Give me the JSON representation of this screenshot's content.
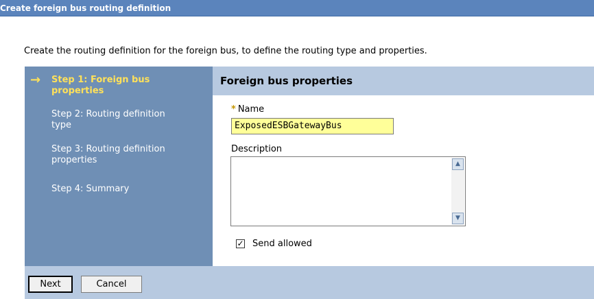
{
  "window": {
    "title": "Create foreign bus routing definition"
  },
  "intro_text": "Create the routing definition for the foreign bus, to define the routing type and properties.",
  "steps": [
    {
      "label": "Step 1: Foreign bus properties",
      "current": true
    },
    {
      "label": "Step 2: Routing definition type",
      "current": false
    },
    {
      "label": "Step 3: Routing definition properties",
      "current": false
    },
    {
      "label": "Step 4: Summary",
      "current": false
    }
  ],
  "current_step_arrow": "→",
  "section": {
    "title": "Foreign bus properties"
  },
  "fields": {
    "name": {
      "label": "Name",
      "value": "ExposedESBGatewayBus",
      "required_marker": "*"
    },
    "description": {
      "label": "Description",
      "value": ""
    },
    "send_allowed": {
      "label": "Send allowed",
      "checked": true,
      "check_glyph": "✓"
    }
  },
  "buttons": {
    "next": "Next",
    "cancel": "Cancel"
  },
  "colors": {
    "title_bar": "#5b84bc",
    "sidebar": "#6f8fb5",
    "panel": "#b7c9e0",
    "current_step": "#ffe15a",
    "required_field": "#ffff99"
  }
}
